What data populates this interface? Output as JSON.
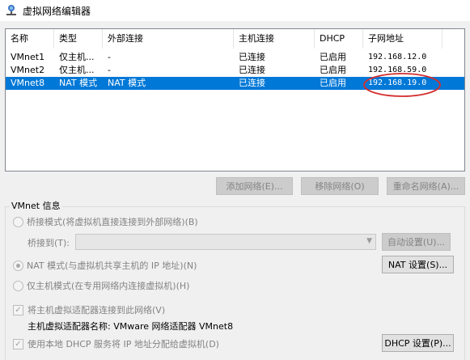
{
  "window": {
    "title": "虚拟网络编辑器",
    "icon": "network-icon"
  },
  "table": {
    "columns": [
      "名称",
      "类型",
      "外部连接",
      "主机连接",
      "DHCP",
      "子网地址"
    ],
    "rows": [
      {
        "name": "VMnet1",
        "type": "仅主机...",
        "external": "-",
        "host": "已连接",
        "dhcp": "已启用",
        "subnet": "192.168.12.0",
        "selected": false
      },
      {
        "name": "VMnet2",
        "type": "仅主机...",
        "external": "-",
        "host": "已连接",
        "dhcp": "已启用",
        "subnet": "192.168.59.0",
        "selected": false
      },
      {
        "name": "VMnet8",
        "type": "NAT 模式",
        "external": "NAT 模式",
        "host": "已连接",
        "dhcp": "已启用",
        "subnet": "192.168.19.0",
        "selected": true
      }
    ],
    "annotation_color": "#d32f2f"
  },
  "buttons": {
    "add_network": "添加网络(E)...",
    "remove_network": "移除网络(O)",
    "rename_network": "重命名网络(A)..."
  },
  "vmnet_info": {
    "group_label": "VMnet 信息",
    "bridged_mode": "桥接模式(将虚拟机直接连接到外部网络)(B)",
    "bridged_to_label": "桥接到(T):",
    "auto_settings": "自动设置(U)...",
    "nat_mode": "NAT 模式(与虚拟机共享主机的 IP 地址)(N)",
    "nat_settings": "NAT 设置(S)...",
    "host_only_mode": "仅主机模式(在专用网络内连接虚拟机)(H)",
    "connect_adapter": "将主机虚拟适配器连接到此网络(V)",
    "adapter_name": "主机虚拟适配器名称: VMware 网络适配器 VMnet8",
    "use_dhcp": "使用本地 DHCP 服务将 IP 地址分配给虚拟机(D)",
    "dhcp_settings": "DHCP 设置(P)..."
  },
  "colors": {
    "selection": "#0078d7",
    "background": "#f0f0f0"
  }
}
